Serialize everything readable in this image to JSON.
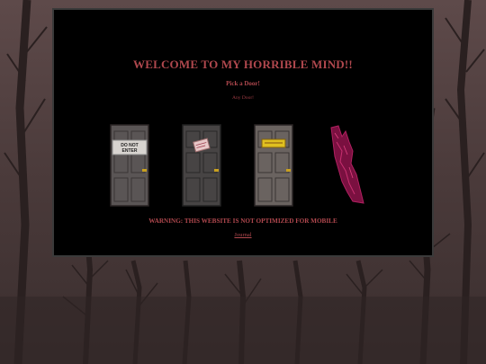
{
  "header": {
    "title": "WELCOME TO MY HORRIBLE MIND!!",
    "subtitle": "Pick a Door!",
    "tagline": "Any Door!"
  },
  "doors": [
    {
      "name": "door-1",
      "sign_text": "DO NOT ENTER"
    },
    {
      "name": "door-2",
      "sign_text": ""
    },
    {
      "name": "door-3",
      "sign_text": "sign"
    },
    {
      "name": "door-4",
      "sign_text": ""
    }
  ],
  "footer": {
    "warning": "WARNING: THIS WEBSITE IS NOT OPTIMIZED FOR MOBILE",
    "link_label": "Journal"
  },
  "colors": {
    "accent": "#b0484e",
    "panel": "#000000",
    "door_gray": "#5a5555"
  }
}
